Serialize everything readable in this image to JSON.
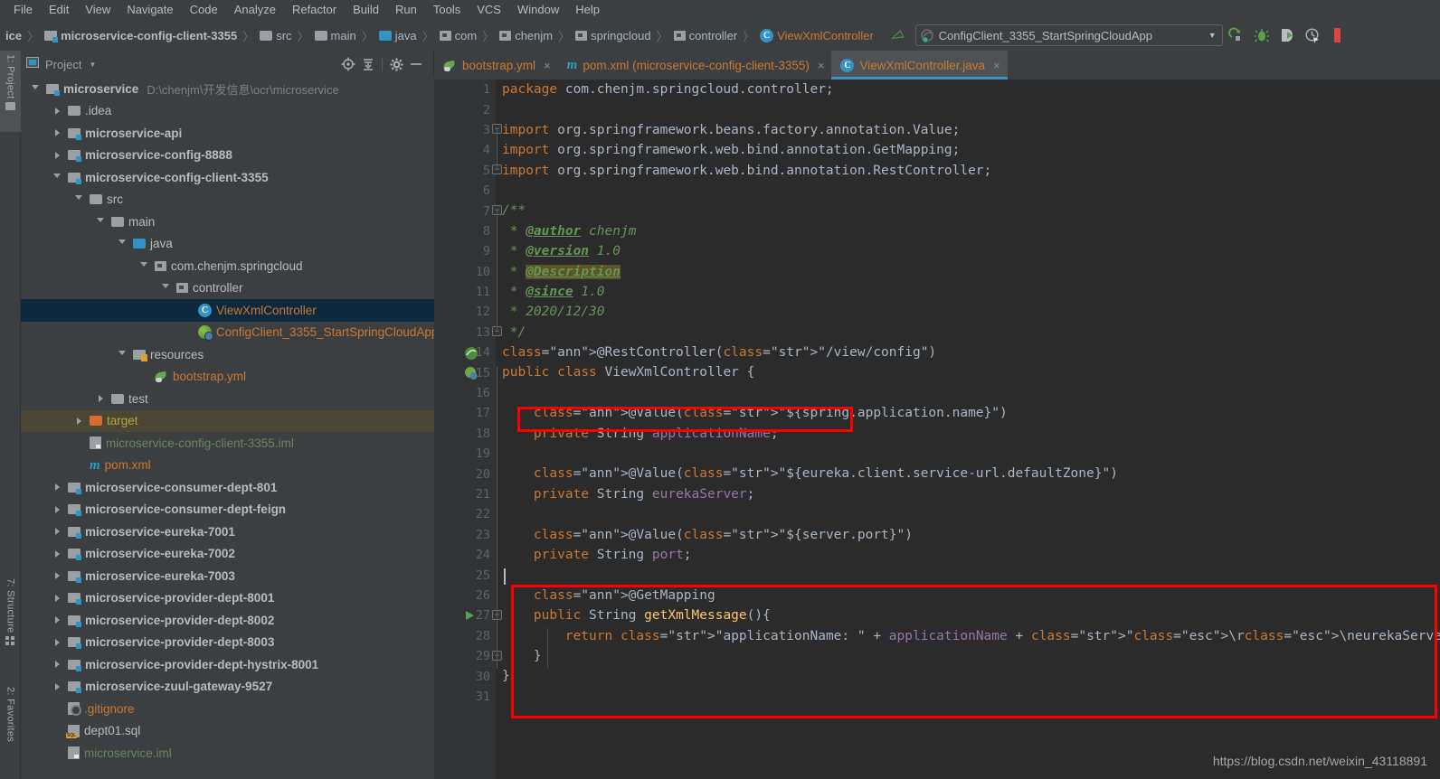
{
  "menu": {
    "items": [
      "File",
      "Edit",
      "View",
      "Navigate",
      "Code",
      "Analyze",
      "Refactor",
      "Build",
      "Run",
      "Tools",
      "VCS",
      "Window",
      "Help"
    ]
  },
  "breadcrumb": {
    "prefix": "ice",
    "items": [
      {
        "label": "microservice-config-client-3355",
        "icon": "module-icon",
        "style": "bold"
      },
      {
        "label": "src",
        "icon": "folder-icon",
        "style": "plain"
      },
      {
        "label": "main",
        "icon": "folder-icon",
        "style": "plain"
      },
      {
        "label": "java",
        "icon": "folder-blue-icon",
        "style": "plain"
      },
      {
        "label": "com",
        "icon": "package-icon",
        "style": "plain"
      },
      {
        "label": "chenjm",
        "icon": "package-icon",
        "style": "plain"
      },
      {
        "label": "springcloud",
        "icon": "package-icon",
        "style": "plain"
      },
      {
        "label": "controller",
        "icon": "package-icon",
        "style": "plain"
      },
      {
        "label": "ViewXmlController",
        "icon": "class-icon",
        "style": "red"
      }
    ]
  },
  "toolbar": {
    "build_icon": "hammer-icon",
    "run_config": {
      "name": "ConfigClient_3355_StartSpringCloudApp",
      "icon": "springboot-run-icon",
      "dropdown_icon": "chevron-down-icon"
    },
    "buttons": [
      {
        "name": "run-button",
        "icon": "run-icon",
        "color": "#5a9e4e"
      },
      {
        "name": "debug-button",
        "icon": "debug-bug-icon",
        "color": "#5a9e4e"
      },
      {
        "name": "run-coverage-button",
        "icon": "coverage-icon",
        "color": "#5a9e4e"
      },
      {
        "name": "profiler-button",
        "icon": "profiler-clock-icon",
        "color": "#b0b0b0"
      }
    ]
  },
  "left_strip": {
    "project": "1: Project",
    "structure": "7: Structure",
    "favorites": "2: Favorites"
  },
  "project_panel": {
    "title": "Project",
    "caret": "chevron-down-icon",
    "buttons": [
      {
        "name": "locate-button",
        "icon": "crosshair-icon"
      },
      {
        "name": "collapse-all-button",
        "icon": "collapse-all-icon"
      },
      {
        "name": "settings-button",
        "icon": "gear-icon"
      },
      {
        "name": "hide-button",
        "icon": "minus-icon"
      }
    ],
    "tree": [
      {
        "indent": 0,
        "twisty": "down",
        "icon": "module-icon",
        "label": "microservice",
        "style": "bold",
        "path": "D:\\chenjm\\开发信息\\ocr\\microservice"
      },
      {
        "indent": 1,
        "twisty": "right",
        "icon": "folder-icon",
        "label": ".idea",
        "style": "plain"
      },
      {
        "indent": 1,
        "twisty": "right",
        "icon": "module-icon",
        "label": "microservice-api",
        "style": "bold"
      },
      {
        "indent": 1,
        "twisty": "right",
        "icon": "module-icon",
        "label": "microservice-config-8888",
        "style": "bold"
      },
      {
        "indent": 1,
        "twisty": "down",
        "icon": "module-icon",
        "label": "microservice-config-client-3355",
        "style": "bold"
      },
      {
        "indent": 2,
        "twisty": "down",
        "icon": "folder-icon",
        "label": "src",
        "style": "plain"
      },
      {
        "indent": 3,
        "twisty": "down",
        "icon": "folder-icon",
        "label": "main",
        "style": "plain"
      },
      {
        "indent": 4,
        "twisty": "down",
        "icon": "folder-blue-icon",
        "label": "java",
        "style": "plain"
      },
      {
        "indent": 5,
        "twisty": "down",
        "icon": "package-icon",
        "label": "com.chenjm.springcloud",
        "style": "plain"
      },
      {
        "indent": 6,
        "twisty": "down",
        "icon": "package-icon",
        "label": "controller",
        "style": "plain"
      },
      {
        "indent": 7,
        "twisty": "none",
        "icon": "class-icon",
        "label": "ViewXmlController",
        "style": "red",
        "row": "selected"
      },
      {
        "indent": 7,
        "twisty": "none",
        "icon": "springboot-icon",
        "label": "ConfigClient_3355_StartSpringCloudApp",
        "style": "red"
      },
      {
        "indent": 4,
        "twisty": "down",
        "icon": "resources-icon",
        "label": "resources",
        "style": "plain"
      },
      {
        "indent": 5,
        "twisty": "none",
        "icon": "yml-icon",
        "label": "bootstrap.yml",
        "style": "red"
      },
      {
        "indent": 3,
        "twisty": "right",
        "icon": "folder-icon",
        "label": "test",
        "style": "plain"
      },
      {
        "indent": 2,
        "twisty": "right",
        "icon": "folder-orange-icon",
        "label": "target",
        "style": "yellow",
        "row": "highlighted"
      },
      {
        "indent": 2,
        "twisty": "none",
        "icon": "iml-icon",
        "label": "microservice-config-client-3355.iml",
        "style": "green"
      },
      {
        "indent": 2,
        "twisty": "none",
        "icon": "maven-icon",
        "label": "pom.xml",
        "style": "red"
      },
      {
        "indent": 1,
        "twisty": "right",
        "icon": "module-icon",
        "label": "microservice-consumer-dept-801",
        "style": "bold"
      },
      {
        "indent": 1,
        "twisty": "right",
        "icon": "module-icon",
        "label": "microservice-consumer-dept-feign",
        "style": "bold"
      },
      {
        "indent": 1,
        "twisty": "right",
        "icon": "module-icon",
        "label": "microservice-eureka-7001",
        "style": "bold"
      },
      {
        "indent": 1,
        "twisty": "right",
        "icon": "module-icon",
        "label": "microservice-eureka-7002",
        "style": "bold"
      },
      {
        "indent": 1,
        "twisty": "right",
        "icon": "module-icon",
        "label": "microservice-eureka-7003",
        "style": "bold"
      },
      {
        "indent": 1,
        "twisty": "right",
        "icon": "module-icon",
        "label": "microservice-provider-dept-8001",
        "style": "bold"
      },
      {
        "indent": 1,
        "twisty": "right",
        "icon": "module-icon",
        "label": "microservice-provider-dept-8002",
        "style": "bold"
      },
      {
        "indent": 1,
        "twisty": "right",
        "icon": "module-icon",
        "label": "microservice-provider-dept-8003",
        "style": "bold"
      },
      {
        "indent": 1,
        "twisty": "right",
        "icon": "module-icon",
        "label": "microservice-provider-dept-hystrix-8001",
        "style": "bold"
      },
      {
        "indent": 1,
        "twisty": "right",
        "icon": "module-icon",
        "label": "microservice-zuul-gateway-9527",
        "style": "bold"
      },
      {
        "indent": 1,
        "twisty": "none",
        "icon": "gitignore-icon",
        "label": ".gitignore",
        "style": "red"
      },
      {
        "indent": 1,
        "twisty": "none",
        "icon": "sql-icon",
        "label": "dept01.sql",
        "style": "plain"
      },
      {
        "indent": 1,
        "twisty": "none",
        "icon": "iml-icon",
        "label": "microservice.iml",
        "style": "green"
      }
    ]
  },
  "editor": {
    "tabs": [
      {
        "label": "bootstrap.yml",
        "icon": "yml-icon",
        "active": false,
        "close": "×"
      },
      {
        "label": "pom.xml (microservice-config-client-3355)",
        "icon": "maven-icon",
        "active": false,
        "close": "×"
      },
      {
        "label": "ViewXmlController.java",
        "icon": "class-icon",
        "active": true,
        "close": "×"
      }
    ],
    "line_numbers": [
      1,
      2,
      3,
      4,
      5,
      6,
      7,
      8,
      9,
      10,
      11,
      12,
      13,
      14,
      15,
      16,
      17,
      18,
      19,
      20,
      21,
      22,
      23,
      24,
      25,
      26,
      27,
      28,
      29,
      30,
      31
    ],
    "code_lines": [
      "package com.chenjm.springcloud.controller;",
      "",
      "import org.springframework.beans.factory.annotation.Value;",
      "import org.springframework.web.bind.annotation.GetMapping;",
      "import org.springframework.web.bind.annotation.RestController;",
      "",
      "/**",
      " * @author chenjm",
      " * @version 1.0",
      " * @Description",
      " * @since 1.0",
      " * 2020/12/30",
      " */",
      "@RestController(\"/view/config\")",
      "public class ViewXmlController {",
      "",
      "    @Value(\"${spring.application.name}\")",
      "    private String applicationName;",
      "",
      "    @Value(\"${eureka.client.service-url.defaultZone}\")",
      "    private String eurekaServer;",
      "",
      "    @Value(\"${server.port}\")",
      "    private String port;",
      "",
      "    @GetMapping",
      "    public String getXmlMessage(){",
      "        return \"applicationName: \" + applicationName + \"\\r\\neurekaServer: \" + eurekaServer + \"\\r\\nport: \" + port;",
      "    }",
      "}",
      ""
    ],
    "gutter_marks": [
      {
        "line": 14,
        "icon": "spring-bean-icon"
      },
      {
        "line": 15,
        "icon": "spring-component-icon"
      },
      {
        "line": 27,
        "icon": "run-gutter-icon"
      }
    ],
    "highlight_boxes": [
      {
        "name": "value-annotation-highlight",
        "lines": "17"
      },
      {
        "name": "getmapping-method-highlight",
        "lines": "25-31"
      }
    ],
    "caret_line": 25
  },
  "watermark": "https://blog.csdn.net/weixin_43118891",
  "colors": {
    "accent": "#3592c4",
    "keyword": "#cc7832",
    "string": "#6a8759",
    "annotation": "#bbb529",
    "comment": "#629755",
    "field": "#9876aa",
    "method": "#ffc66d",
    "highlight_red": "#ff0000",
    "selection": "#0d293e",
    "editor_bg": "#2b2b2b",
    "panel_bg": "#3c3f41"
  }
}
